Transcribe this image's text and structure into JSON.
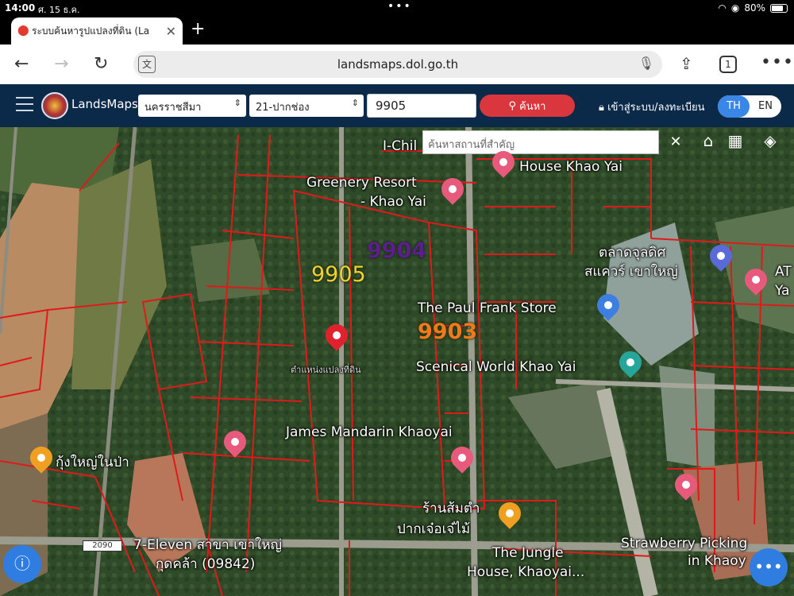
{
  "status_bar": {
    "time": "14:00",
    "date": "ศ. 15 ธ.ค.",
    "battery": "80%"
  },
  "browser": {
    "tab_title": "ระบบค้นหารูปแปลงที่ดิน (La",
    "url": "landsmaps.dol.go.th",
    "tab_count": "1"
  },
  "app": {
    "brand": "LandsMaps",
    "province": "นครราชสีมา",
    "district": "21-ปากช่อง",
    "parcel_query": "9905",
    "search_label": "ค้นหา",
    "login_label": "เข้าสู่ระบบ/ลงทะเบียน",
    "lang_th": "TH",
    "lang_en": "EN"
  },
  "map": {
    "place_search_placeholder": "ค้นหาสถานที่สำคัญ",
    "parcel_labels": [
      {
        "text": "9905",
        "color": "#f2d230"
      },
      {
        "text": "9904",
        "color": "#5a1f8a"
      },
      {
        "text": "9903",
        "color": "#f07a1a"
      }
    ],
    "place_labels": [
      "I-Chil",
      "Greenery Resort",
      "- Khao Yai",
      "House Khao Yai",
      "ตลาดจุลดิศ",
      "สแควร์ เขาใหญ่",
      "AT",
      "Ya",
      "The Paul Frank Store",
      "Scenical World Khao Yai",
      "James Mandarin Khaoyai",
      "กุ้งใหญ่ในป่า",
      "ร้านส้มตำ",
      "ปากเจ๋อเจ๋ไม้",
      "7-Eleven สาขา เขาใหญ่",
      "กุดคล้า (09842)",
      "The Jungle",
      "House, Khaoyai...",
      "Strawberry Picking",
      "in Khaoy",
      "ตำแหน่งแปลงที่ดิน"
    ],
    "road_badge": "2090"
  }
}
